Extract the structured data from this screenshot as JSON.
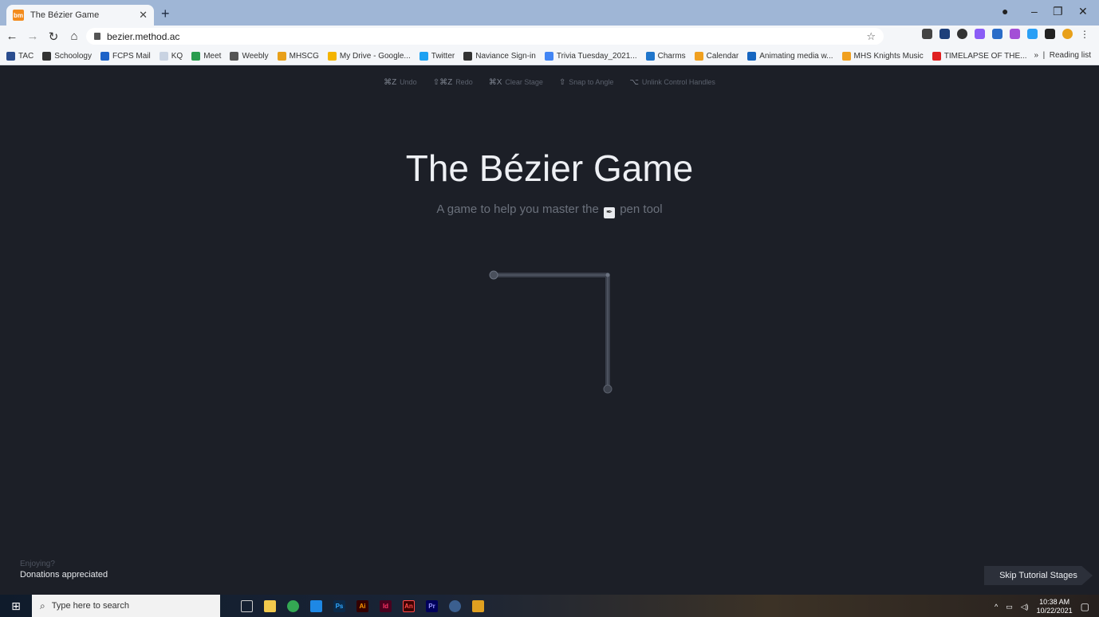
{
  "browser": {
    "tab_title": "The Bézier Game",
    "tab_favicon": "bm",
    "url": "bezier.method.ac",
    "bookmarks": [
      {
        "label": "TAC",
        "color": "#2a4d8f"
      },
      {
        "label": "Schoology",
        "color": "#333333"
      },
      {
        "label": "FCPS Mail",
        "color": "#1e63c8"
      },
      {
        "label": "KQ",
        "color": "#c9d3e2"
      },
      {
        "label": "Meet",
        "color": "#2a9d4f"
      },
      {
        "label": "Weebly",
        "color": "#555555"
      },
      {
        "label": "MHSCG",
        "color": "#e8a01a"
      },
      {
        "label": "My Drive - Google...",
        "color": "#f4b400"
      },
      {
        "label": "Twitter",
        "color": "#1da1f2"
      },
      {
        "label": "Naviance Sign-in",
        "color": "#333333"
      },
      {
        "label": "Trivia Tuesday_2021...",
        "color": "#4285f4"
      },
      {
        "label": "Charms",
        "color": "#1f75cb"
      },
      {
        "label": "Calendar",
        "color": "#f0a020"
      },
      {
        "label": "Animating media w...",
        "color": "#1565c0"
      },
      {
        "label": "MHS Knights Music",
        "color": "#f0a020"
      },
      {
        "label": "TIMELAPSE OF THE...",
        "color": "#e02020"
      }
    ],
    "reading_list": "Reading list"
  },
  "shortcuts": [
    {
      "key": "⌘Z",
      "label": "Undo"
    },
    {
      "key": "⇧⌘Z",
      "label": "Redo"
    },
    {
      "key": "⌘X",
      "label": "Clear Stage"
    },
    {
      "key": "⇧",
      "label": "Snap to Angle"
    },
    {
      "key": "⌥",
      "label": "Unlink Control Handles"
    }
  ],
  "game": {
    "title": "The Bézier Game",
    "subtitle_pre": "A game to help you master the",
    "subtitle_post": "pen tool"
  },
  "donate": {
    "question": "Enjoying?",
    "text": "Donations appreciated"
  },
  "skip_label": "Skip Tutorial Stages",
  "taskbar": {
    "search_placeholder": "Type here to search",
    "time": "10:38 AM",
    "date": "10/22/2021"
  }
}
